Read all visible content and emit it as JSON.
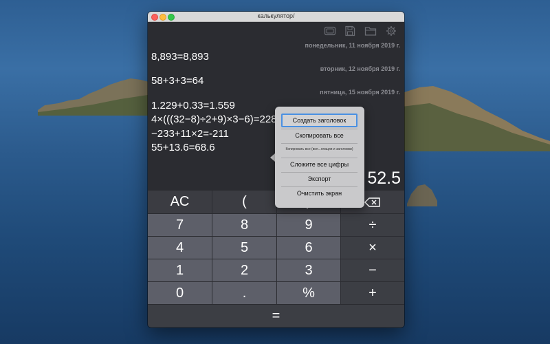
{
  "window": {
    "title": "калькулятор/"
  },
  "toolbar": {
    "icons": [
      "screen-icon",
      "save-icon",
      "folder-icon",
      "gear-icon"
    ]
  },
  "history": [
    {
      "date": "понедельник, 11 ноября 2019 г.",
      "lines": [
        "8,893=8,893"
      ]
    },
    {
      "date": "вторник, 12 ноября 2019 г.",
      "lines": [
        "58+3+3=64"
      ]
    },
    {
      "date": "пятница, 15 ноября 2019 г.",
      "lines": [
        "1.229+0.33=1.559",
        "4×(((32−8)÷2+9)×3−6)=228",
        "−233+11×2=-211",
        "55+13.6=68.6"
      ]
    }
  ],
  "display": {
    "value": "52.5"
  },
  "keys": {
    "ac": "AC",
    "paren_open": "(",
    "paren_close": ")",
    "backspace": "⌫",
    "seven": "7",
    "eight": "8",
    "nine": "9",
    "divide": "÷",
    "four": "4",
    "five": "5",
    "six": "6",
    "multiply": "×",
    "one": "1",
    "two": "2",
    "three": "3",
    "minus": "−",
    "zero": "0",
    "dot": ".",
    "percent": "%",
    "plus": "+",
    "equals": "="
  },
  "context_menu": {
    "items": [
      "Создать заголовок",
      "Скопировать все",
      "Копировать все (вкл...опации и заголовки)",
      "Сложите все цифры",
      "Экспорт",
      "Очистить экран"
    ]
  },
  "colors": {
    "accent": "#4a90e2",
    "window_bg": "#2b2c31",
    "key_num": "#5d5f69",
    "key_fn": "#3c3e44"
  }
}
